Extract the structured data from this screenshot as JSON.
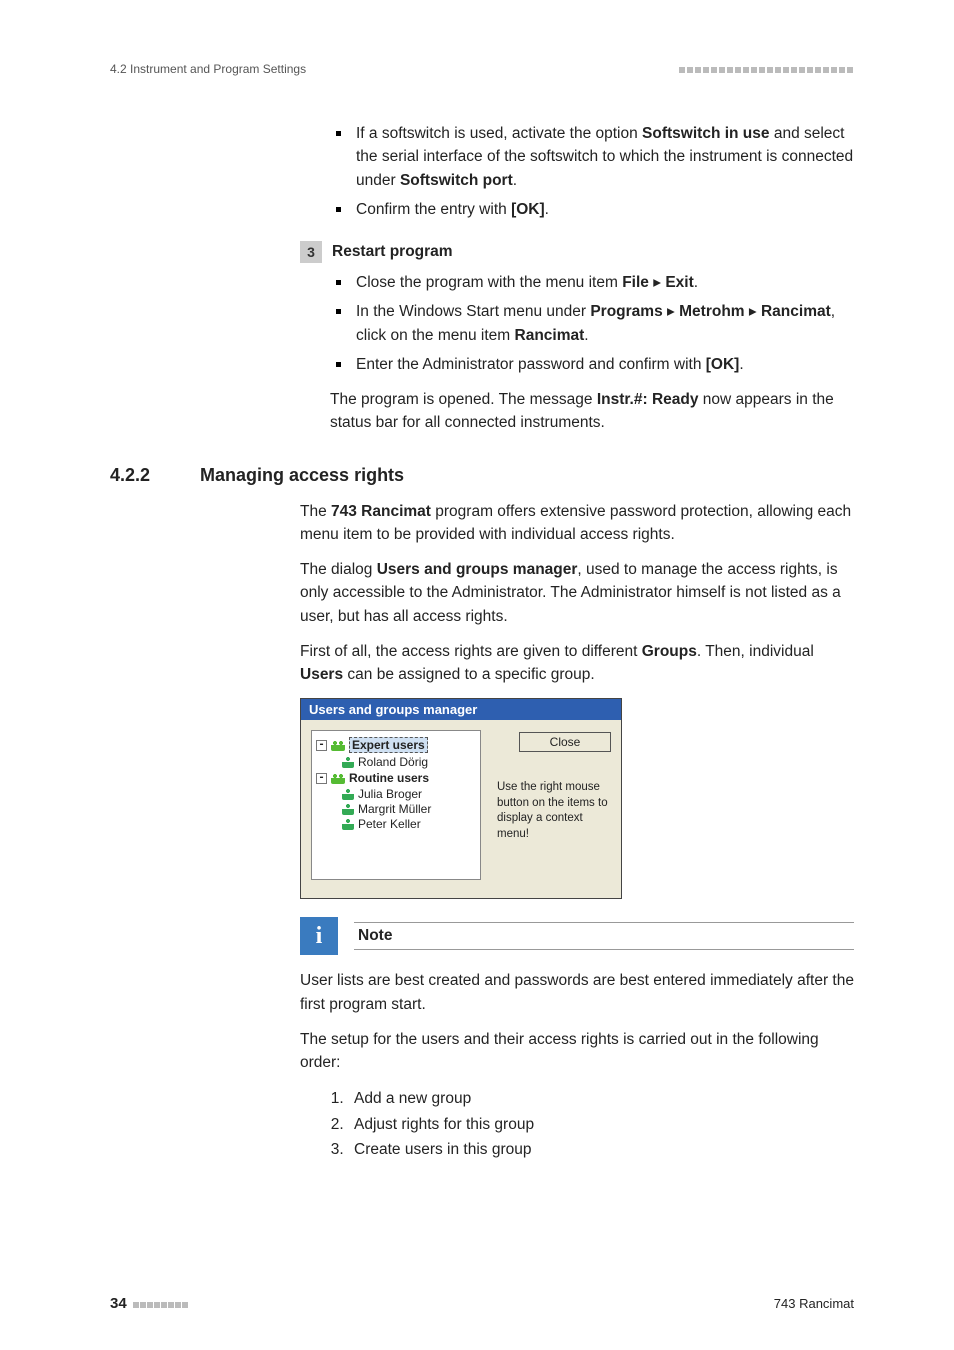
{
  "header": {
    "left": "4.2 Instrument and Program Settings"
  },
  "bullets_pre": [
    {
      "pre": "If a softswitch is used, activate the option ",
      "b1": "Softswitch in use",
      "mid": " and select the serial interface of the softswitch to which the instrument is connected under ",
      "b2": "Softswitch port",
      "post": "."
    },
    {
      "pre": "Confirm the entry with ",
      "b1": "[OK]",
      "post": "."
    }
  ],
  "step3": {
    "num": "3",
    "title": "Restart program",
    "items": [
      {
        "pre": "Close the program with the menu item ",
        "b1": "File",
        "sep": " ▸ ",
        "b2": "Exit",
        "post": "."
      },
      {
        "pre": "In the Windows Start menu under ",
        "b1": "Programs",
        "s1": " ▸ ",
        "b2": "Metrohm",
        "s2": " ▸ ",
        "b3": "Rancimat",
        "mid": ", click on the menu item ",
        "b4": "Rancimat",
        "post": "."
      },
      {
        "pre": "Enter the Administrator password and confirm with ",
        "b1": "[OK]",
        "post": "."
      }
    ],
    "after": {
      "pre": "The program is opened. The message ",
      "b1": "Instr.#: Ready",
      "post": " now appears in the status bar for all connected instruments."
    }
  },
  "section": {
    "num": "4.2.2",
    "title": "Managing access rights",
    "p1": {
      "pre": "The ",
      "b1": "743 Rancimat",
      "post": " program offers extensive password protection, allowing each menu item to be provided with individual access rights."
    },
    "p2": {
      "pre": "The dialog ",
      "b1": "Users and groups manager",
      "post": ", used to manage the access rights, is only accessible to the Administrator. The Administrator himself is not listed as a user, but has all access rights."
    },
    "p3": {
      "pre": "First of all, the access rights are given to different ",
      "b1": "Groups",
      "mid": ". Then, individual ",
      "b2": "Users",
      "post": " can be assigned to a specific group."
    }
  },
  "dialog": {
    "title": "Users and groups manager",
    "groups": [
      {
        "name": "Expert users",
        "users": [
          "Roland Dörig"
        ]
      },
      {
        "name": "Routine users",
        "users": [
          "Julia Broger",
          "Margrit Müller",
          "Peter Keller"
        ]
      }
    ],
    "close": "Close",
    "hint": "Use the right mouse button on the items to display a context menu!"
  },
  "note": {
    "label": "Note",
    "body": "User lists are best created and passwords are best entered immediately after the first program start."
  },
  "after_note": "The setup for the users and their access rights is carried out in the following order:",
  "ordered": [
    "Add a new group",
    "Adjust rights for this group",
    "Create users in this group"
  ],
  "footer": {
    "page": "34",
    "product": "743 Rancimat"
  }
}
